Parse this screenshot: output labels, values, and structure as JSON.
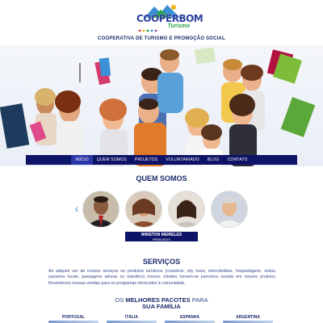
{
  "header": {
    "logo_word": "COOPERBOM",
    "logo_sub": "Turismo",
    "tagline": "COOPERATIVA DE TURISMO E PROMOÇÃO SOCIAL"
  },
  "nav": {
    "items": [
      {
        "label": "INÍCIO",
        "active": true
      },
      {
        "label": "QUEM SOMOS"
      },
      {
        "label": "PROJETOS"
      },
      {
        "label": "VOLUNTARIADO"
      },
      {
        "label": "BLOG"
      },
      {
        "label": "CONTATO"
      }
    ]
  },
  "quem_somos": {
    "title": "QUEM SOMOS",
    "featured_name": "WINSTON MEIRELES",
    "featured_role": "PRESIDENTE"
  },
  "servicos": {
    "title": "SERVIÇOS",
    "text": "Ao adquirir um de nossos serviços ou produtos turísticos (cruzeiros, city tours, intercâmbios, hospedagens, vistos, passeios locais, passagens aéreas ou transfers) nossos clientes tornam-se parceiros sociais em nossos projetos. Revertemos nossas vendas para os programas oferecidos à comunidade."
  },
  "pacotes": {
    "title_pre": "OS ",
    "title_bold": "MELHORES PACOTES",
    "title_post": " PARA",
    "title_line2": "SUA FAMÍLIA",
    "destinations": [
      "PORTUGAL",
      "ITÁLIA",
      "ESPANHA",
      "ARGENTINA"
    ]
  },
  "colors": {
    "navy": "#0d1366",
    "nav_active": "#2b37a8",
    "accent_green": "#2aa24a",
    "arrow_blue": "#3b8fd4"
  }
}
